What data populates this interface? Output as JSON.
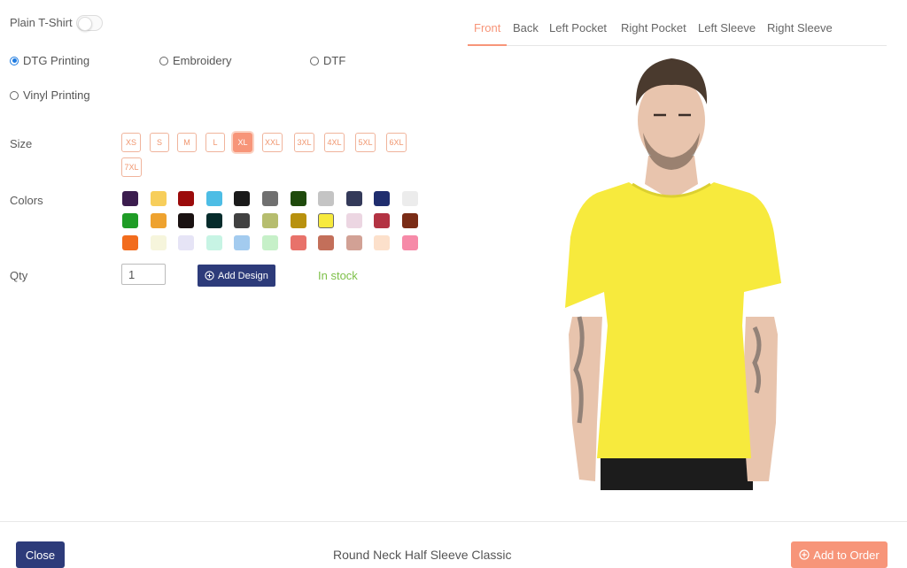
{
  "plain_tshirt": {
    "label": "Plain T-Shirt",
    "enabled": false
  },
  "print_methods": [
    {
      "label": "DTG Printing",
      "selected": true
    },
    {
      "label": "Embroidery",
      "selected": false
    },
    {
      "label": "DTF",
      "selected": false
    },
    {
      "label": "Vinyl Printing",
      "selected": false
    }
  ],
  "size": {
    "label": "Size",
    "options": [
      "XS",
      "S",
      "M",
      "L",
      "XL",
      "XXL",
      "3XL",
      "4XL",
      "5XL",
      "6XL",
      "7XL"
    ],
    "selected": "XL"
  },
  "colors": {
    "label": "Colors",
    "swatches": [
      "#3b1c4e",
      "#f7ce5b",
      "#9b0b0b",
      "#4dbde5",
      "#1a1a1a",
      "#707070",
      "#1f4a0c",
      "#c4c4c4",
      "#343a5a",
      "#1f2d6e",
      "#ececec",
      "#1f9c26",
      "#eea22f",
      "#1a1212",
      "#062c2c",
      "#414141",
      "#b6bd6e",
      "#b8910e",
      "#f7ea3d",
      "#ecd6e2",
      "#b33343",
      "#7a2c16",
      "#f26c1d",
      "#f6f5dc",
      "#e6e4f6",
      "#c7f4e4",
      "#a3cbef",
      "#c6f0c8",
      "#e8726a",
      "#c36f5a",
      "#d2a195",
      "#fce0cb",
      "#f68aa8"
    ],
    "selected": "#f7ea3d"
  },
  "qty": {
    "label": "Qty",
    "value": "1"
  },
  "add_design": {
    "label": "Add Design",
    "icon": "plus-circle-icon"
  },
  "stock_status": "In stock",
  "view_tabs": {
    "items": [
      "Front",
      "Back",
      "Left Pocket",
      "Right Pocket",
      "Left Sleeve",
      "Right Sleeve"
    ],
    "active": "Front"
  },
  "preview": {
    "tshirt_color": "#f7ea3d",
    "pants_color": "#1c1c1c",
    "skin_color": "#e8c4ad",
    "hair_color": "#4a3a2e"
  },
  "footer": {
    "close_label": "Close",
    "product_title": "Round Neck Half Sleeve Classic",
    "add_to_order_label": "Add to Order",
    "add_to_order_icon": "plus-circle-icon"
  }
}
